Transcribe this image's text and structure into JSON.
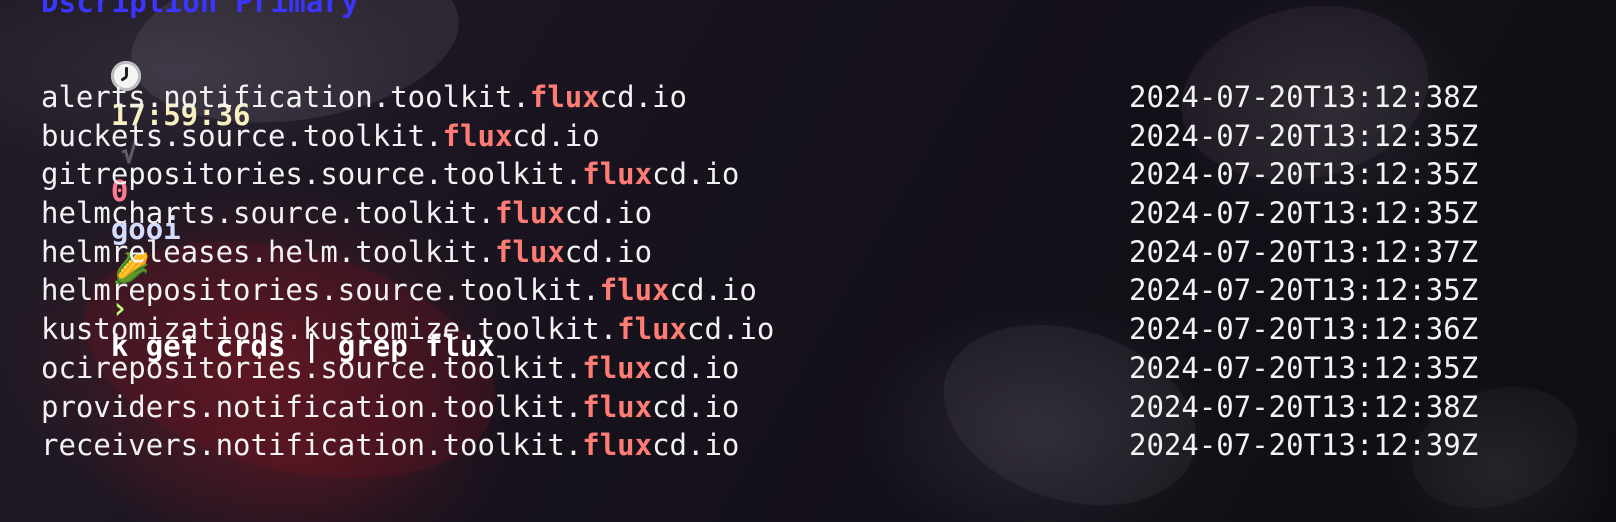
{
  "terminal": {
    "top_line_text": "Dscription Primary",
    "prompt": {
      "time": "17:59:36",
      "branch_marker": "√",
      "count": "0",
      "context": "gooi",
      "corn_icon": "🌽",
      "chevron": "›",
      "command": "k get crds | grep flux"
    },
    "rows": [
      {
        "name_prefix": "alerts.notification.toolkit.",
        "match": "flux",
        "name_suffix": "cd.io",
        "created_at": "2024-07-20T13:12:38Z"
      },
      {
        "name_prefix": "buckets.source.toolkit.",
        "match": "flux",
        "name_suffix": "cd.io",
        "created_at": "2024-07-20T13:12:35Z"
      },
      {
        "name_prefix": "gitrepositories.source.toolkit.",
        "match": "flux",
        "name_suffix": "cd.io",
        "created_at": "2024-07-20T13:12:35Z"
      },
      {
        "name_prefix": "helmcharts.source.toolkit.",
        "match": "flux",
        "name_suffix": "cd.io",
        "created_at": "2024-07-20T13:12:35Z"
      },
      {
        "name_prefix": "helmreleases.helm.toolkit.",
        "match": "flux",
        "name_suffix": "cd.io",
        "created_at": "2024-07-20T13:12:37Z"
      },
      {
        "name_prefix": "helmrepositories.source.toolkit.",
        "match": "flux",
        "name_suffix": "cd.io",
        "created_at": "2024-07-20T13:12:35Z"
      },
      {
        "name_prefix": "kustomizations.kustomize.toolkit.",
        "match": "flux",
        "name_suffix": "cd.io",
        "created_at": "2024-07-20T13:12:36Z"
      },
      {
        "name_prefix": "ocirepositories.source.toolkit.",
        "match": "flux",
        "name_suffix": "cd.io",
        "created_at": "2024-07-20T13:12:35Z"
      },
      {
        "name_prefix": "providers.notification.toolkit.",
        "match": "flux",
        "name_suffix": "cd.io",
        "created_at": "2024-07-20T13:12:38Z"
      },
      {
        "name_prefix": "receivers.notification.toolkit.",
        "match": "flux",
        "name_suffix": "cd.io",
        "created_at": "2024-07-20T13:12:39Z"
      }
    ],
    "colors": {
      "background": "#131018",
      "text": "#f2f2f2",
      "match": "#ff7c74",
      "time": "#f8f0c0",
      "chevron": "#b7ff78",
      "count": "#ff7a8f"
    },
    "icons": [
      "clock-icon",
      "corn-icon"
    ]
  }
}
